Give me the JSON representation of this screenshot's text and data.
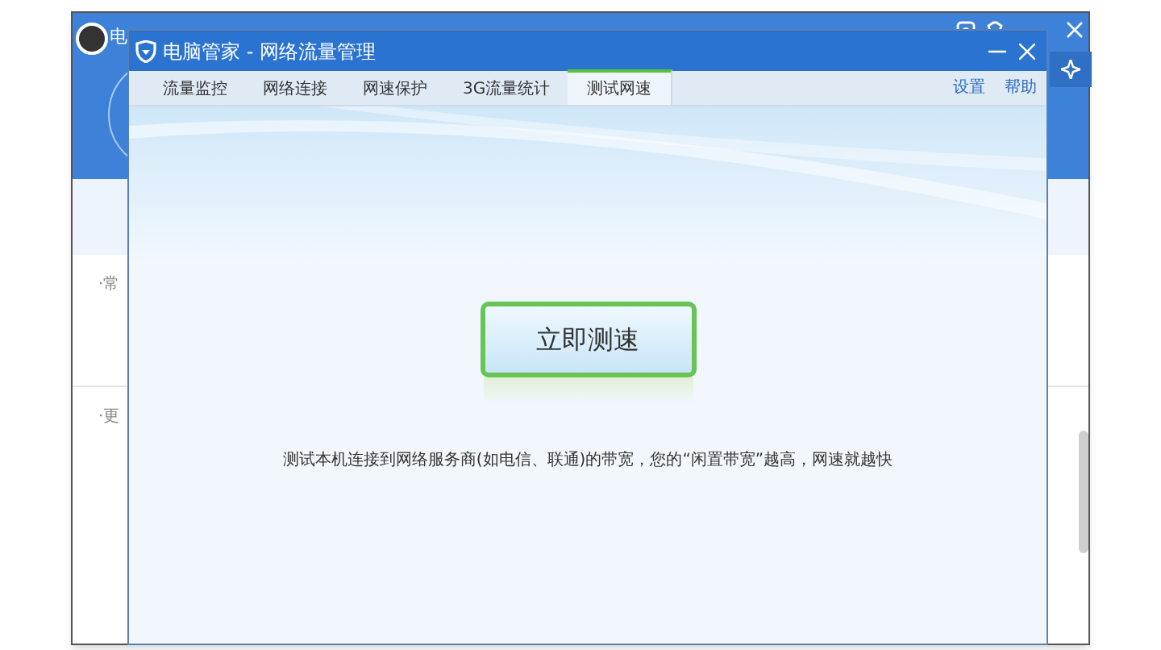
{
  "back_window": {
    "title": "电",
    "sections": [
      {
        "label": "·常"
      },
      {
        "label": "·更"
      }
    ]
  },
  "window": {
    "title": "电脑管家 - 网络流量管理"
  },
  "tabs": [
    {
      "label": "流量监控",
      "selected": false
    },
    {
      "label": "网络连接",
      "selected": false
    },
    {
      "label": "网速保护",
      "selected": false
    },
    {
      "label": "3G流量统计",
      "selected": false
    },
    {
      "label": "测试网速",
      "selected": true
    }
  ],
  "links": [
    "设置",
    "帮助"
  ],
  "test_button": {
    "label": "立即测速"
  },
  "description": "测试本机连接到网络服务商(如电信、联通)的带宽，您的“闲置带宽”越高，网速就越快"
}
